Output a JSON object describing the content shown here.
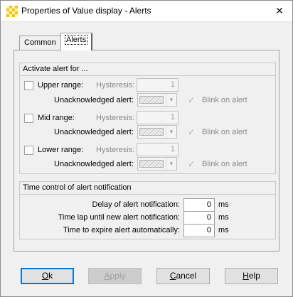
{
  "window": {
    "title": "Properties of Value display - Alerts",
    "close_glyph": "✕",
    "app_icon": "yellow-checker-icon"
  },
  "tabs": [
    {
      "label": "Common"
    },
    {
      "label": "Alerts"
    }
  ],
  "activate_group": {
    "header": "Activate alert for ...",
    "rows": [
      {
        "range_label": "Upper range:",
        "hysteresis_label": "Hysteresis:",
        "hysteresis_value": "1",
        "unack_label": "Unacknowledged alert:",
        "blink_label": "Blink on alert"
      },
      {
        "range_label": "Mid range:",
        "hysteresis_label": "Hysteresis:",
        "hysteresis_value": "1",
        "unack_label": "Unacknowledged alert:",
        "blink_label": "Blink on alert"
      },
      {
        "range_label": "Lower range:",
        "hysteresis_label": "Hysteresis:",
        "hysteresis_value": "1",
        "unack_label": "Unacknowledged alert:",
        "blink_label": "Blink on alert"
      }
    ]
  },
  "time_group": {
    "header": "Time control of alert notification",
    "fields": [
      {
        "label": "Delay of alert notification:",
        "value": "0",
        "unit": "ms"
      },
      {
        "label": "Time lap until new alert notification:",
        "value": "0",
        "unit": "ms"
      },
      {
        "label": "Time to expire alert automatically:",
        "value": "0",
        "unit": "ms"
      }
    ]
  },
  "buttons": {
    "ok": {
      "mnemonic": "O",
      "rest": "k"
    },
    "apply": {
      "mnemonic": "A",
      "rest": "pply"
    },
    "cancel": {
      "mnemonic": "C",
      "rest": "ancel"
    },
    "help": {
      "mnemonic": "H",
      "rest": "elp"
    }
  },
  "icons": {
    "check_glyph": "✓",
    "dropdown_glyph": "▼"
  }
}
